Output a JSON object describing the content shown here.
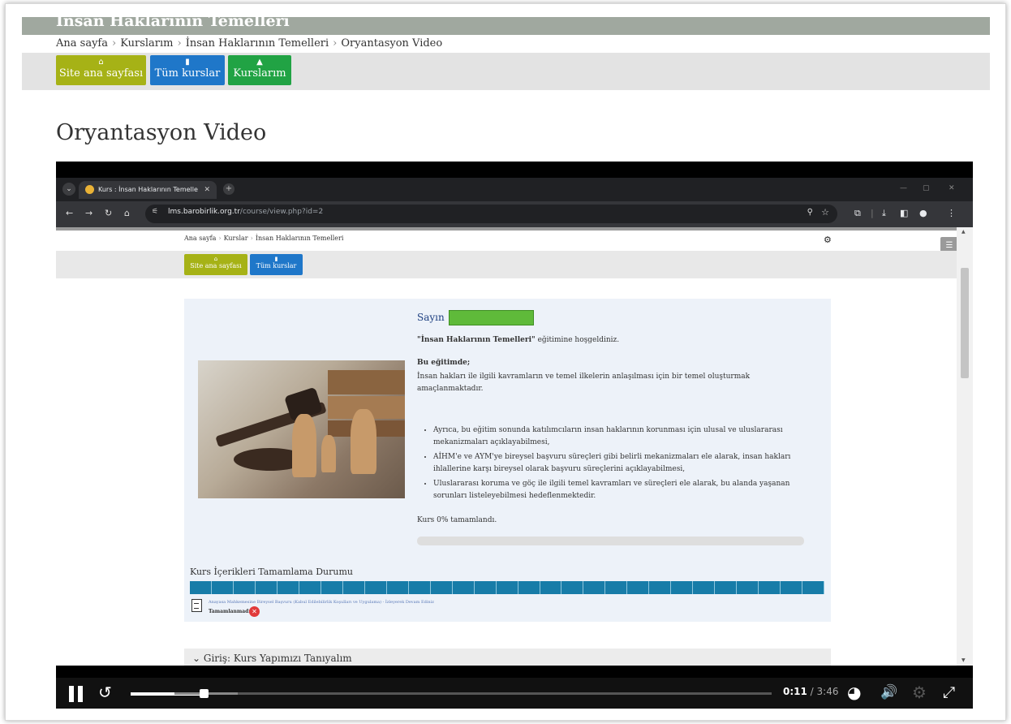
{
  "course_header": {
    "title": "İnsan Haklarının Temelleri"
  },
  "breadcrumb": [
    "Ana sayfa",
    "Kurslarım",
    "İnsan Haklarının Temelleri",
    "Oryantasyon Video"
  ],
  "nav_buttons": {
    "site_home": "Site ana sayfası",
    "all_courses": "Tüm kurslar",
    "my_courses": "Kurslarım",
    "colors": {
      "site_home": "#a6b216",
      "all_courses": "#1f77c9",
      "my_courses": "#21a344"
    }
  },
  "page_title": "Oryantasyon Video",
  "video": {
    "browser": {
      "tab_title": "Kurs : İnsan Haklarının Temelle",
      "url_host": "lms.barobirlik.org.tr",
      "url_path": "/course/view.php?id=2"
    },
    "inner_page": {
      "breadcrumb": [
        "Ana sayfa",
        "Kurslar",
        "İnsan Haklarının Temelleri"
      ],
      "buttons": {
        "site_home": "Site ana sayfası",
        "all_courses": "Tüm kurslar"
      },
      "greeting": "Sayın",
      "welcome_bold": "\"İnsan Haklarının Temelleri\"",
      "welcome_rest": " eğitimine hoşgeldiniz.",
      "bu_egitimde": "Bu eğitimde;",
      "description": "İnsan hakları ile ilgili kavramların ve temel ilkelerin anlaşılması için bir temel oluşturmak amaçlanmaktadır.",
      "bullets": [
        "Ayrıca, bu eğitim sonunda katılımcıların insan haklarının korunması için ulusal ve uluslararası mekanizmaları açıklayabilmesi,",
        "AİHM'e ve AYM'ye bireysel başvuru süreçleri gibi belirli mekanizmaları ele alarak, insan hakları ihlallerine karşı bireysel olarak başvuru süreçlerini açıklayabilmesi,",
        "Uluslararası koruma ve göç ile ilgili temel kavramları ve süreçleri ele alarak, bu alanda yaşanan sorunları listeleyebilmesi hedeflenmektedir."
      ],
      "course_progress_text": "Kurs 0% tamamlandı.",
      "course_progress_fraction": 0,
      "completion_title": "Kurs İçerikleri Tamamlama Durumu",
      "completion_segments": 29,
      "activity_link": "Anayasa Mahkemesine Bireysel Başvuru (Kabul Edilebilirlik Koşulları ve Uygulama) - İzleyerek Devam Ediniz",
      "activity_status": "Tamamlanmadı",
      "section_title": "Giriş: Kurs Yapımızı Tanıyalım"
    },
    "player": {
      "current_time": "0:11",
      "total_time": "3:46",
      "time_separator": " / ",
      "progress_fraction": 0.049
    }
  }
}
